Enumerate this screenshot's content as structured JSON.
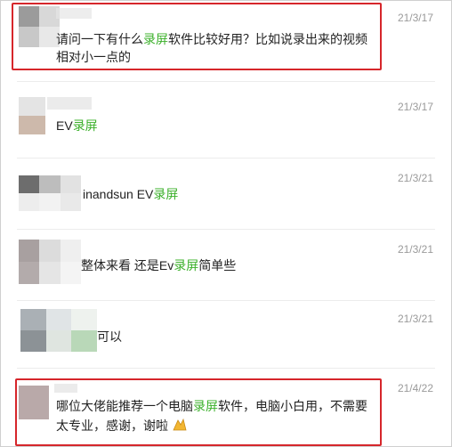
{
  "comments": [
    {
      "time": "21/3/17",
      "text_parts": [
        "请问一下有什么",
        "录屏",
        "软件比较好用？比如说录出来的视频"
      ],
      "text_line2": "相对小一点的",
      "highlighted": true
    },
    {
      "time": "21/3/17",
      "text_parts": [
        "EV",
        "录屏",
        ""
      ]
    },
    {
      "time": "21/3/21",
      "text_parts": [
        "inandsun EV",
        "录屏",
        ""
      ]
    },
    {
      "time": "21/3/21",
      "text_parts": [
        "整体来看 还是Ev",
        "录屏",
        "简单些"
      ]
    },
    {
      "time": "21/3/21",
      "text_parts": [
        "可以",
        "",
        ""
      ]
    },
    {
      "time": "21/4/22",
      "text_parts": [
        "哪位大佬能推荐一个电脑",
        "录屏",
        "软件，电脑小白用，不需要"
      ],
      "text_line2": "太专业，感谢，谢啦",
      "highlighted": true
    }
  ],
  "colors": {
    "highlight_text": "#3bb02a",
    "highlight_box": "#d6262b",
    "timestamp": "#9a9a9a"
  }
}
